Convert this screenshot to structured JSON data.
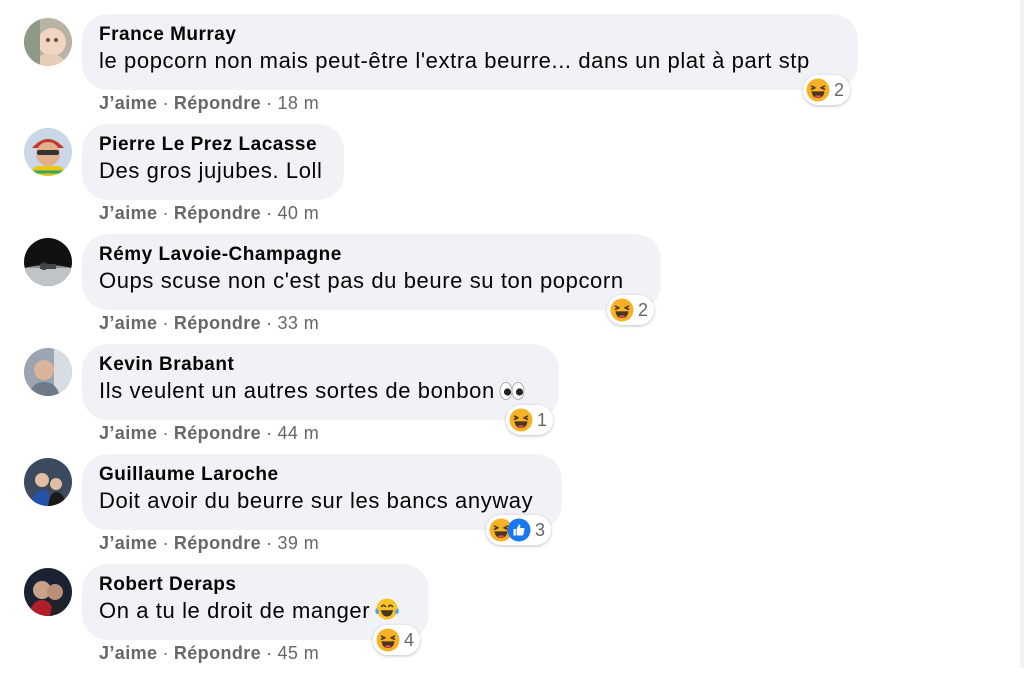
{
  "actions": {
    "like": "J’aime",
    "reply": "Répondre",
    "separator": "·"
  },
  "colors": {
    "bubble": "#f0f2f5",
    "meta": "#65676b",
    "haha": "#f7b125",
    "like": "#1877f2"
  },
  "comments": [
    {
      "author": "France Murray",
      "text": "le popcorn non mais peut-être l'extra beurre... dans un plat à part stp",
      "time": "18 m",
      "reaction_count": "2",
      "reactions": [
        "haha-icon"
      ]
    },
    {
      "author": "Pierre Le Prez Lacasse",
      "text": "Des gros jujubes. Loll",
      "time": "40 m",
      "reaction_count": "",
      "reactions": []
    },
    {
      "author": "Rémy Lavoie-Champagne",
      "text": "Oups scuse non c'est pas du beure su ton popcorn",
      "time": "33 m",
      "reaction_count": "2",
      "reactions": [
        "haha-icon"
      ]
    },
    {
      "author": "Kevin Brabant",
      "text": "Ils veulent un autres sortes de bonbon",
      "time": "44 m",
      "reaction_count": "1",
      "reactions": [
        "haha-icon"
      ],
      "inline_emoji": "eyes-emoji"
    },
    {
      "author": "Guillaume Laroche",
      "text": "Doit avoir du beurre sur les bancs anyway",
      "time": "39 m",
      "reaction_count": "3",
      "reactions": [
        "haha-icon",
        "like-icon"
      ]
    },
    {
      "author": "Robert Deraps",
      "text": "On a tu le droit de manger",
      "time": "45 m",
      "reaction_count": "4",
      "reactions": [
        "haha-icon"
      ],
      "inline_emoji": "tears-of-joy-emoji"
    }
  ]
}
